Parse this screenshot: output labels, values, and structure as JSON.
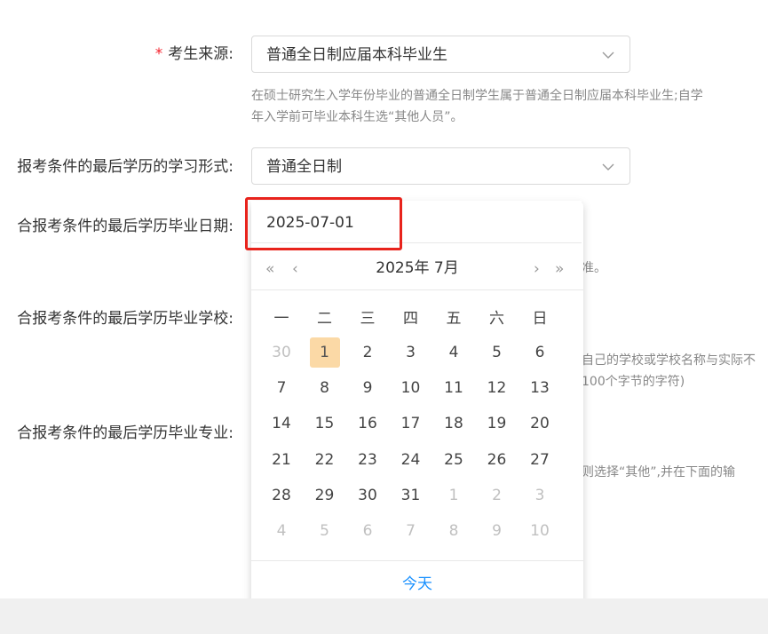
{
  "form": {
    "source": {
      "required_mark": "*",
      "label": "考生来源:",
      "value": "普通全日制应届本科毕业生",
      "hint_line1": "在硕士研究生入学年份毕业的普通全日制学生属于普通全日制应届本科毕业生;自学",
      "hint_line2": "年入学前可毕业本科生选“其他人员”。"
    },
    "study_form": {
      "label": "报考条件的最后学历的学习形式:",
      "value": "普通全日制"
    },
    "grad_date": {
      "label": "合报考条件的最后学历毕业日期:",
      "value": "2025-07-01",
      "hint_tail": "准。"
    },
    "grad_school": {
      "label": "合报考条件的最后学历毕业学校:",
      "hint_line1": "自己的学校或学校名称与实际不",
      "hint_line2": "100个字节的字符)"
    },
    "grad_major": {
      "label": "合报考条件的最后学历毕业专业:",
      "hint_line1": "则选择“其他”,并在下面的输"
    }
  },
  "calendar": {
    "title": "2025年 7月",
    "nav_prev_year": "«",
    "nav_prev_month": "‹",
    "nav_next_month": "›",
    "nav_next_year": "»",
    "weekdays": [
      "一",
      "二",
      "三",
      "四",
      "五",
      "六",
      "日"
    ],
    "weeks": [
      [
        "30",
        "1",
        "2",
        "3",
        "4",
        "5",
        "6"
      ],
      [
        "7",
        "8",
        "9",
        "10",
        "11",
        "12",
        "13"
      ],
      [
        "14",
        "15",
        "16",
        "17",
        "18",
        "19",
        "20"
      ],
      [
        "21",
        "22",
        "23",
        "24",
        "25",
        "26",
        "27"
      ],
      [
        "28",
        "29",
        "30",
        "31",
        "1",
        "2",
        "3"
      ],
      [
        "4",
        "5",
        "6",
        "7",
        "8",
        "9",
        "10"
      ]
    ],
    "selected_day": "1",
    "today_label": "今天"
  },
  "colors": {
    "required": "#f5222d",
    "highlight_box": "#e8231c",
    "selected_day_bg": "#fbd9a6",
    "link": "#1890ff"
  }
}
